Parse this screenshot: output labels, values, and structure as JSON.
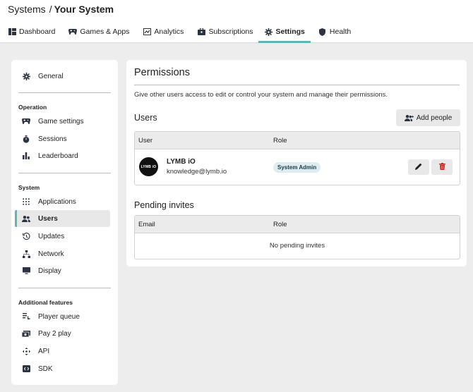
{
  "header": {
    "breadcrumb_root": "Systems",
    "breadcrumb_sep": "/",
    "breadcrumb_current": "Your System"
  },
  "tabs": [
    {
      "label": "Dashboard",
      "icon": "dashboard-icon"
    },
    {
      "label": "Games & Apps",
      "icon": "gamepad-icon"
    },
    {
      "label": "Analytics",
      "icon": "analytics-icon"
    },
    {
      "label": "Subscriptions",
      "icon": "briefcase-icon"
    },
    {
      "label": "Settings",
      "icon": "gear-icon",
      "active": true
    },
    {
      "label": "Health",
      "icon": "shield-icon"
    }
  ],
  "sidebar": {
    "general": "General",
    "sections": [
      {
        "heading": "Operation",
        "items": [
          {
            "label": "Game settings",
            "icon": "gamepad-icon"
          },
          {
            "label": "Sessions",
            "icon": "stopwatch-icon"
          },
          {
            "label": "Leaderboard",
            "icon": "bar-chart-icon"
          }
        ]
      },
      {
        "heading": "System",
        "items": [
          {
            "label": "Applications",
            "icon": "apps-grid-icon"
          },
          {
            "label": "Users",
            "icon": "users-icon",
            "active": true
          },
          {
            "label": "Updates",
            "icon": "history-icon"
          },
          {
            "label": "Network",
            "icon": "network-icon"
          },
          {
            "label": "Display",
            "icon": "monitor-icon"
          }
        ]
      },
      {
        "heading": "Additional features",
        "items": [
          {
            "label": "Player queue",
            "icon": "queue-icon"
          },
          {
            "label": "Pay 2 play",
            "icon": "money-icon"
          },
          {
            "label": "API",
            "icon": "api-icon"
          },
          {
            "label": "SDK",
            "icon": "sdk-icon"
          }
        ]
      }
    ]
  },
  "permissions": {
    "title": "Permissions",
    "description": "Give other users access to edit or control your system and manage their permissions.",
    "users_heading": "Users",
    "add_people_label": "Add people",
    "users_table": {
      "col_user": "User",
      "col_role": "Role",
      "rows": [
        {
          "avatar_text": "LYMB iO",
          "name": "LYMB iO",
          "email": "knowledge@lymb.io",
          "role": "System Admin"
        }
      ]
    },
    "pending_heading": "Pending invites",
    "pending_table": {
      "col_email": "Email",
      "col_role": "Role",
      "empty_text": "No pending invites"
    }
  },
  "colors": {
    "accent": "#5fb4b9",
    "delete_icon": "#c62828",
    "badge_bg": "#dcecef"
  }
}
